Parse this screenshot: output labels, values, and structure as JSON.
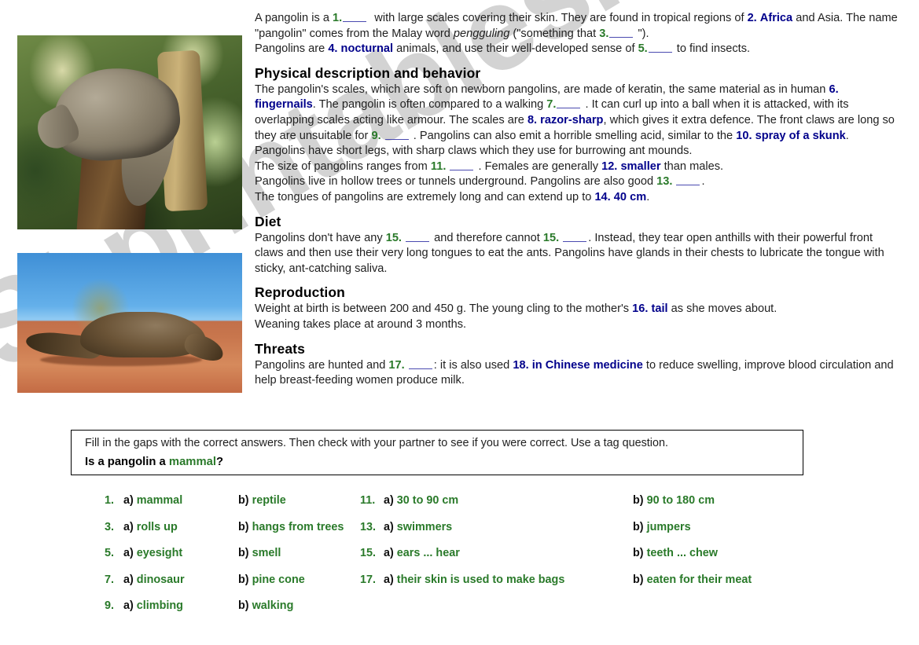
{
  "watermark": {
    "text": "ESLprintables.com"
  },
  "images": [
    {
      "name": "pangolin-on-tree-stump-photo",
      "alt": "Pangolin climbing a tree stump with green foliage background"
    },
    {
      "name": "pangolin-walking-on-sand-photo",
      "alt": "Pangolin walking on red sand under a blue sky"
    }
  ],
  "intro": {
    "p1_a": "A pangolin is a",
    "n1": "1.",
    "p1_b": "with large scales covering their skin.  They are found in tropical regions of",
    "n2": "2.",
    "a2": "Africa",
    "p1_c": "and Asia. The name \"pangolin\" comes from the Malay word",
    "malay_word": "pengguling",
    "p1_d": "(\"something that",
    "n3": "3.",
    "p1_e": "\").",
    "p1_f": "Pangolins are",
    "n4": "4.",
    "a4": "nocturnal",
    "p1_g": "animals, and use their well-developed sense of",
    "n5": "5.",
    "p1_h": "to find insects."
  },
  "physical": {
    "heading": "Physical description and behavior",
    "t_a": "The pangolin's scales, which are soft on newborn pangolins, are made of keratin, the same material as in human",
    "n6": "6.",
    "a6": "fingernails",
    "t_b": ". The pangolin is often compared to a walking",
    "n7": "7.",
    "t_c": ".  It can curl up into a ball when it is attacked, with its overlapping scales acting like armour. The scales are",
    "n8": "8.",
    "a8": "razor-sharp",
    "t_d": ", which gives it extra defence. The front claws are long so they are unsuitable for",
    "n9": "9.",
    "t_e": ".  Pangolins can also emit a horrible smelling acid, similar to the",
    "n10": "10.",
    "a10": "spray of a skunk",
    "t_f": ". Pangolins have short legs, with sharp claws which they use for burrowing ant mounds.",
    "t_g": "The size of pangolins ranges from",
    "n11": "11.",
    "t_h": ".  Females are generally",
    "n12": "12.",
    "a12": "smaller",
    "t_i": "than males.",
    "t_j": "Pangolins live in hollow trees or tunnels underground. Pangolins are also good",
    "n13": "13.",
    "t_k": ".",
    "t_l": "The tongues of pangolins are extremely long and can extend up to",
    "n14": "14.",
    "a14": "40 cm",
    "t_m": "."
  },
  "diet": {
    "heading": "Diet",
    "t_a": "Pangolins don't have any",
    "n15a": "15.",
    "t_b": "and therefore cannot",
    "n15b": "15.",
    "t_c": ".  Instead, they tear open anthills with their powerful front claws and then use their very long tongues to eat the ants. Pangolins have glands in their chests to lubricate the tongue with sticky, ant-catching saliva."
  },
  "reproduction": {
    "heading": "Reproduction",
    "t_a": "Weight at birth is between 200 and 450 g. The young cling to the mother's",
    "n16": "16.",
    "a16": "tail",
    "t_b": "as she moves about.",
    "t_c": "Weaning takes place at around 3 months."
  },
  "threats": {
    "heading": "Threats",
    "t_a": "Pangolins are hunted and",
    "n17": "17.",
    "t_b": ":  it is also used",
    "n18": "18.",
    "a18": "in Chinese medicine",
    "t_c": "to reduce swelling, improve blood circulation and help breast-feeding women produce milk."
  },
  "instructions": {
    "line1": "Fill in the gaps with the correct answers.  Then check with your partner to see if you were correct.  Use a tag question.",
    "line2_pre": "Is a pangolin a",
    "line2_key": "mammal",
    "line2_post": "?"
  },
  "answer_key": {
    "left_column": [
      {
        "q": "1.",
        "a_label": "a)",
        "a_text": "mammal",
        "b_label": "b)",
        "b_text": "reptile"
      },
      {
        "q": "3.",
        "a_label": "a)",
        "a_text": "rolls up",
        "b_label": "b)",
        "b_text": "hangs from trees"
      },
      {
        "q": "5.",
        "a_label": "a)",
        "a_text": "eyesight",
        "b_label": "b)",
        "b_text": "smell"
      },
      {
        "q": "7.",
        "a_label": "a)",
        "a_text": "dinosaur",
        "b_label": "b)",
        "b_text": "pine cone"
      },
      {
        "q": "9.",
        "a_label": "a)",
        "a_text": "climbing",
        "b_label": "b)",
        "b_text": "walking"
      }
    ],
    "right_column": [
      {
        "q": "11.",
        "a_label": "a)",
        "a_text": "30 to 90 cm",
        "b_label": "b)",
        "b_text": "90 to 180 cm"
      },
      {
        "q": "13.",
        "a_label": "a)",
        "a_text": "swimmers",
        "b_label": "b)",
        "b_text": "jumpers"
      },
      {
        "q": "15.",
        "a_label": "a)",
        "a_text": "ears ... hear",
        "b_label": "b)",
        "b_text": "teeth ... chew"
      },
      {
        "q": "17.",
        "a_label": "a)",
        "a_text": "their skin is used to make bags",
        "b_label": "b)",
        "b_text": "eaten for their meat"
      }
    ]
  },
  "colors": {
    "answer_navy": "#00008b",
    "number_green": "#2a7a2a",
    "watermark_gray": "#cccccc",
    "text_black": "#1f1f1f"
  }
}
